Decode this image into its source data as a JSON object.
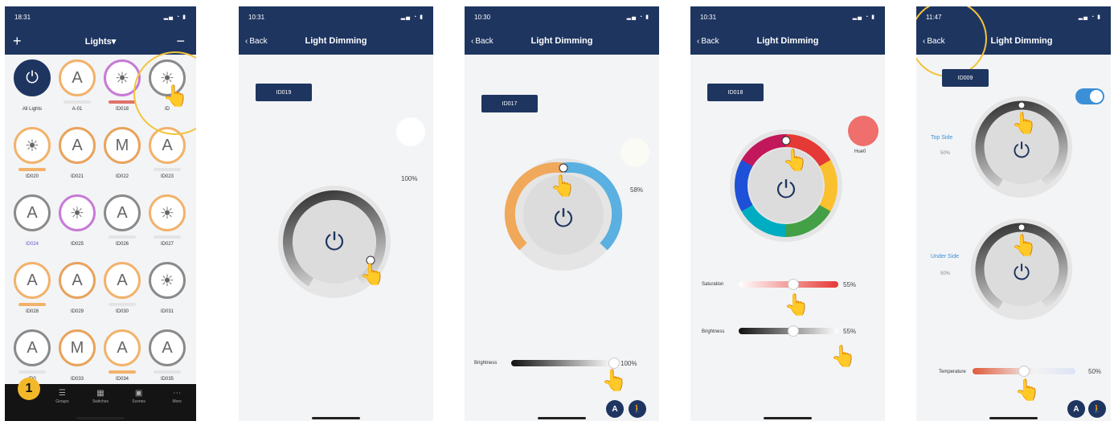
{
  "screens": [
    {
      "time": "18:31",
      "title": "Lights▾",
      "plus": "+",
      "minus": "−",
      "lights": [
        {
          "label": "All Lights",
          "icon": "⏻",
          "style": "power",
          "bar": "none"
        },
        {
          "label": "A-01",
          "icon": "A",
          "style": "warm",
          "bar": "grey"
        },
        {
          "label": "ID018",
          "icon": "☀",
          "style": "rgb",
          "bar": "red"
        },
        {
          "label": "ID",
          "icon": "☀",
          "style": "grey",
          "bar": "none"
        },
        {
          "label": "ID020",
          "icon": "☀",
          "style": "warm",
          "bar": "warm"
        },
        {
          "label": "ID021",
          "icon": "A",
          "style": "mix",
          "bar": "none"
        },
        {
          "label": "ID022",
          "icon": "M",
          "style": "mix",
          "bar": "none"
        },
        {
          "label": "ID023",
          "icon": "A",
          "style": "warm",
          "bar": "grey"
        },
        {
          "label": "ID024",
          "icon": "A",
          "style": "grey",
          "bar": "none",
          "blue": true
        },
        {
          "label": "ID025",
          "icon": "☀",
          "style": "rgb",
          "bar": "none"
        },
        {
          "label": "ID026",
          "icon": "A",
          "style": "grey",
          "bar": "grey"
        },
        {
          "label": "ID027",
          "icon": "☀",
          "style": "warm",
          "bar": "grey"
        },
        {
          "label": "ID028",
          "icon": "A",
          "style": "warm",
          "bar": "warm"
        },
        {
          "label": "ID029",
          "icon": "A",
          "style": "mix",
          "bar": "none"
        },
        {
          "label": "ID030",
          "icon": "A",
          "style": "warm",
          "bar": "grey"
        },
        {
          "label": "ID031",
          "icon": "☀",
          "style": "grey",
          "bar": "none"
        },
        {
          "label": "ID0",
          "icon": "A",
          "style": "grey",
          "bar": "grey"
        },
        {
          "label": "ID033",
          "icon": "M",
          "style": "mix",
          "bar": "none"
        },
        {
          "label": "ID034",
          "icon": "A",
          "style": "warm",
          "bar": "warm"
        },
        {
          "label": "ID035",
          "icon": "A",
          "style": "grey",
          "bar": "grey"
        }
      ],
      "tabs": [
        {
          "label": "",
          "icon": "◉"
        },
        {
          "label": "Groups",
          "icon": "☰"
        },
        {
          "label": "Switches",
          "icon": "▦"
        },
        {
          "label": "Scenes",
          "icon": "▣"
        },
        {
          "label": "More",
          "icon": "⋯"
        }
      ],
      "step": "1"
    },
    {
      "time": "10:31",
      "back": "Back",
      "title": "Light Dimming",
      "id": "ID019",
      "percent": "100%"
    },
    {
      "time": "10:30",
      "back": "Back",
      "title": "Light Dimming",
      "id": "ID017",
      "percent": "58%",
      "brightness_label": "Brightness",
      "brightness_value": "100%",
      "brightness_fraction": 1.0,
      "auto_button": "A"
    },
    {
      "time": "10:31",
      "back": "Back",
      "title": "Light Dimming",
      "id": "ID018",
      "hue_label": "Hue0",
      "saturation_label": "Saturation",
      "saturation_value": "55%",
      "saturation_fraction": 0.55,
      "brightness_label": "Brightness",
      "brightness_value": "55%",
      "brightness_fraction": 0.55
    },
    {
      "time": "11:47",
      "back": "Back",
      "title": "Light Dimming",
      "id": "ID009",
      "top_label": "Top Side",
      "top_value": "50%",
      "under_label": "Under Side",
      "under_value": "50%",
      "temperature_label": "Temperature",
      "temperature_value": "50%",
      "temperature_fraction": 0.5,
      "auto_button": "A"
    }
  ],
  "colors": {
    "navy": "#1e3560",
    "accent_blue": "#3b8fd6",
    "highlight": "#f2c43b",
    "hue_swatch": "#ee6f6b"
  }
}
